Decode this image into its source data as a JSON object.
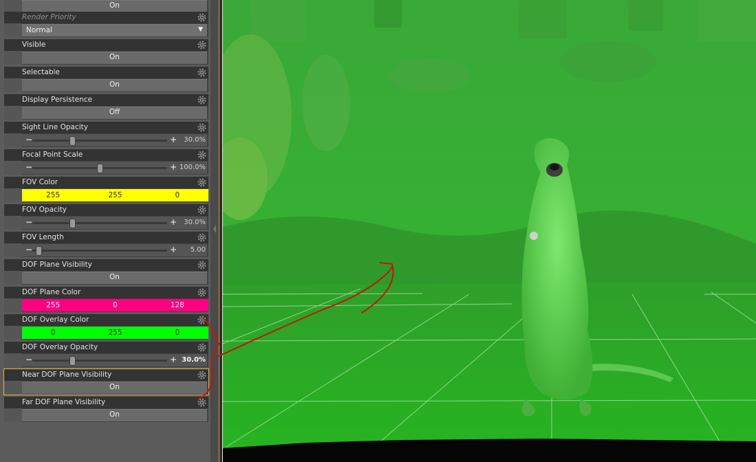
{
  "params": {
    "top_partial": {
      "value": "On"
    },
    "render_priority": {
      "label": "Render Priority",
      "value": "Normal",
      "arrow": "▼"
    },
    "visible": {
      "label": "Visible",
      "value": "On"
    },
    "selectable": {
      "label": "Selectable",
      "value": "On"
    },
    "display_persistence": {
      "label": "Display Persistence",
      "value": "Off"
    },
    "sight_line_opacity": {
      "label": "Sight Line Opacity",
      "value": "30.0%",
      "fraction": 0.3
    },
    "focal_point_scale": {
      "label": "Focal Point Scale",
      "value": "100.0%",
      "fraction": 0.5
    },
    "fov_color": {
      "label": "FOV Color",
      "r": "255",
      "g": "255",
      "b": "0",
      "hex": "#ffff00"
    },
    "fov_opacity": {
      "label": "FOV Opacity",
      "value": "30.0%",
      "fraction": 0.3
    },
    "fov_length": {
      "label": "FOV Length",
      "value": "5.00",
      "fraction": 0.05
    },
    "dof_plane_visibility": {
      "label": "DOF Plane Visibility",
      "value": "On"
    },
    "dof_plane_color": {
      "label": "DOF Plane Color",
      "r": "255",
      "g": "0",
      "b": "128",
      "hex": "#ff0080"
    },
    "dof_overlay_color": {
      "label": "DOF Overlay Color",
      "r": "0",
      "g": "255",
      "b": "0",
      "hex": "#00ff00"
    },
    "dof_overlay_opacity": {
      "label": "DOF Overlay Opacity",
      "value": "30.0%",
      "fraction": 0.3
    },
    "near_dof_plane_visibility": {
      "label": "Near DOF Plane Visibility",
      "value": "On"
    },
    "far_dof_plane_visibility": {
      "label": "Far DOF Plane Visibility",
      "value": "On"
    }
  },
  "symbols": {
    "minus": "−",
    "plus": "+"
  },
  "colors": {
    "panel_bg": "#5b5b5b",
    "header_bg": "#333333",
    "selection_border": "#e8b44a",
    "viewport_green": "#2fb52a",
    "annotation_red": "#c0180c"
  }
}
